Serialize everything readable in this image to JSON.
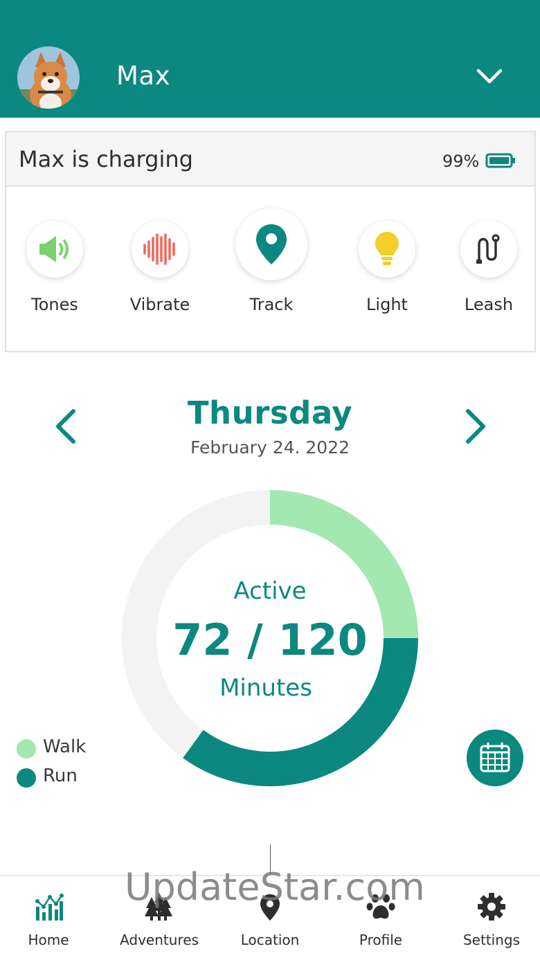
{
  "header": {
    "pet_name": "Max",
    "accent_color": "#0b887f"
  },
  "status": {
    "text": "Max is charging",
    "battery": "99%"
  },
  "actions": [
    {
      "label": "Tones",
      "icon": "speaker-icon",
      "color": "#7bd16d"
    },
    {
      "label": "Vibrate",
      "icon": "vibrate-icon",
      "color": "#ef6a5b"
    },
    {
      "label": "Track",
      "icon": "location-pin-icon",
      "color": "#0b887f"
    },
    {
      "label": "Light",
      "icon": "lightbulb-icon",
      "color": "#f2cf2a"
    },
    {
      "label": "Leash",
      "icon": "leash-icon",
      "color": "#2e2e2e"
    }
  ],
  "day": {
    "title": "Thursday",
    "date": "February 24. 2022"
  },
  "activity": {
    "label": "Active",
    "value": "72 / 120",
    "unit": "Minutes",
    "current": 72,
    "goal": 120,
    "walk_fraction": 0.25,
    "run_fraction": 0.35
  },
  "legend": [
    {
      "label": "Walk",
      "color": "#a3e8b0"
    },
    {
      "label": "Run",
      "color": "#0b887f"
    }
  ],
  "tabs": [
    {
      "label": "Home",
      "icon": "chart-icon",
      "active": true
    },
    {
      "label": "Adventures",
      "icon": "trees-icon",
      "active": false
    },
    {
      "label": "Location",
      "icon": "location-pin-icon",
      "active": false
    },
    {
      "label": "Profile",
      "icon": "paw-icon",
      "active": false
    },
    {
      "label": "Settings",
      "icon": "gear-icon",
      "active": false
    }
  ],
  "watermark": "UpdateStar.com"
}
